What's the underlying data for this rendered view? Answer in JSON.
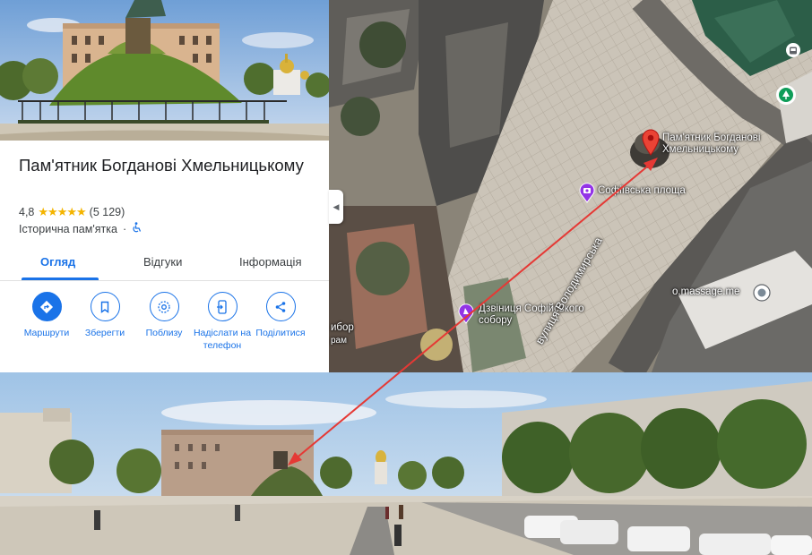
{
  "place": {
    "title": "Пам'ятник Богданові Хмельницькому",
    "rating": "4,8",
    "stars": "★★★★★",
    "review_count": "(5 129)",
    "category": "Історична пам'ятка",
    "accessibility_icon": "wheelchair-icon"
  },
  "tabs": [
    {
      "label": "Огляд",
      "active": true
    },
    {
      "label": "Відгуки",
      "active": false
    },
    {
      "label": "Інформація",
      "active": false
    }
  ],
  "actions": [
    {
      "label": "Маршрути",
      "icon": "directions-icon"
    },
    {
      "label": "Зберегти",
      "icon": "bookmark-icon"
    },
    {
      "label": "Поблизу",
      "icon": "nearby-icon"
    },
    {
      "label": "Надіслати на телефон",
      "icon": "send-to-phone-icon"
    },
    {
      "label": "Поділитися",
      "icon": "share-icon"
    }
  ],
  "map": {
    "pin_label": "Пам'ятник Богданові Хмельницькому",
    "square_label": "Софіївська площа",
    "bell_tower_label": "Дзвіниця Софійського собору",
    "partial_label": "ибор",
    "partial_label_2": "рам",
    "street_label": "вулиця Володимирська",
    "poi_label": "o.massage.me",
    "collapse_glyph": "◀",
    "colors": {
      "pin": "#ea4335",
      "poi_purple": "#9334e6",
      "arrow": "#e53935",
      "accent": "#1a73e8"
    }
  }
}
